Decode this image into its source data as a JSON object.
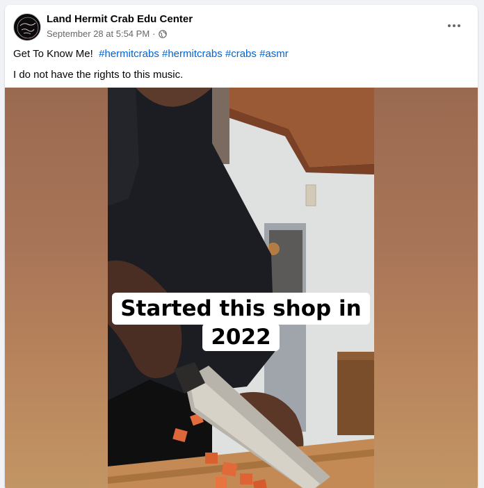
{
  "post": {
    "page_name": "Land Hermit Crab Edu Center",
    "timestamp": "September 28 at 5:54 PM",
    "separator": "·",
    "privacy_icon": "globe-icon",
    "more_icon": "more-options-icon",
    "caption_text": "Get To Know Me!",
    "hashtags": [
      "#hermitcrabs",
      "#hermitcrabs",
      "#crabs",
      "#asmr"
    ],
    "caption_line2": "I do not have the rights to this music."
  },
  "video": {
    "overlay_line1": "Started this shop in",
    "overlay_line2": "2022"
  },
  "colors": {
    "link": "#0064d1",
    "meta": "#65676b",
    "text": "#050505",
    "media_bg": "#a97558"
  }
}
